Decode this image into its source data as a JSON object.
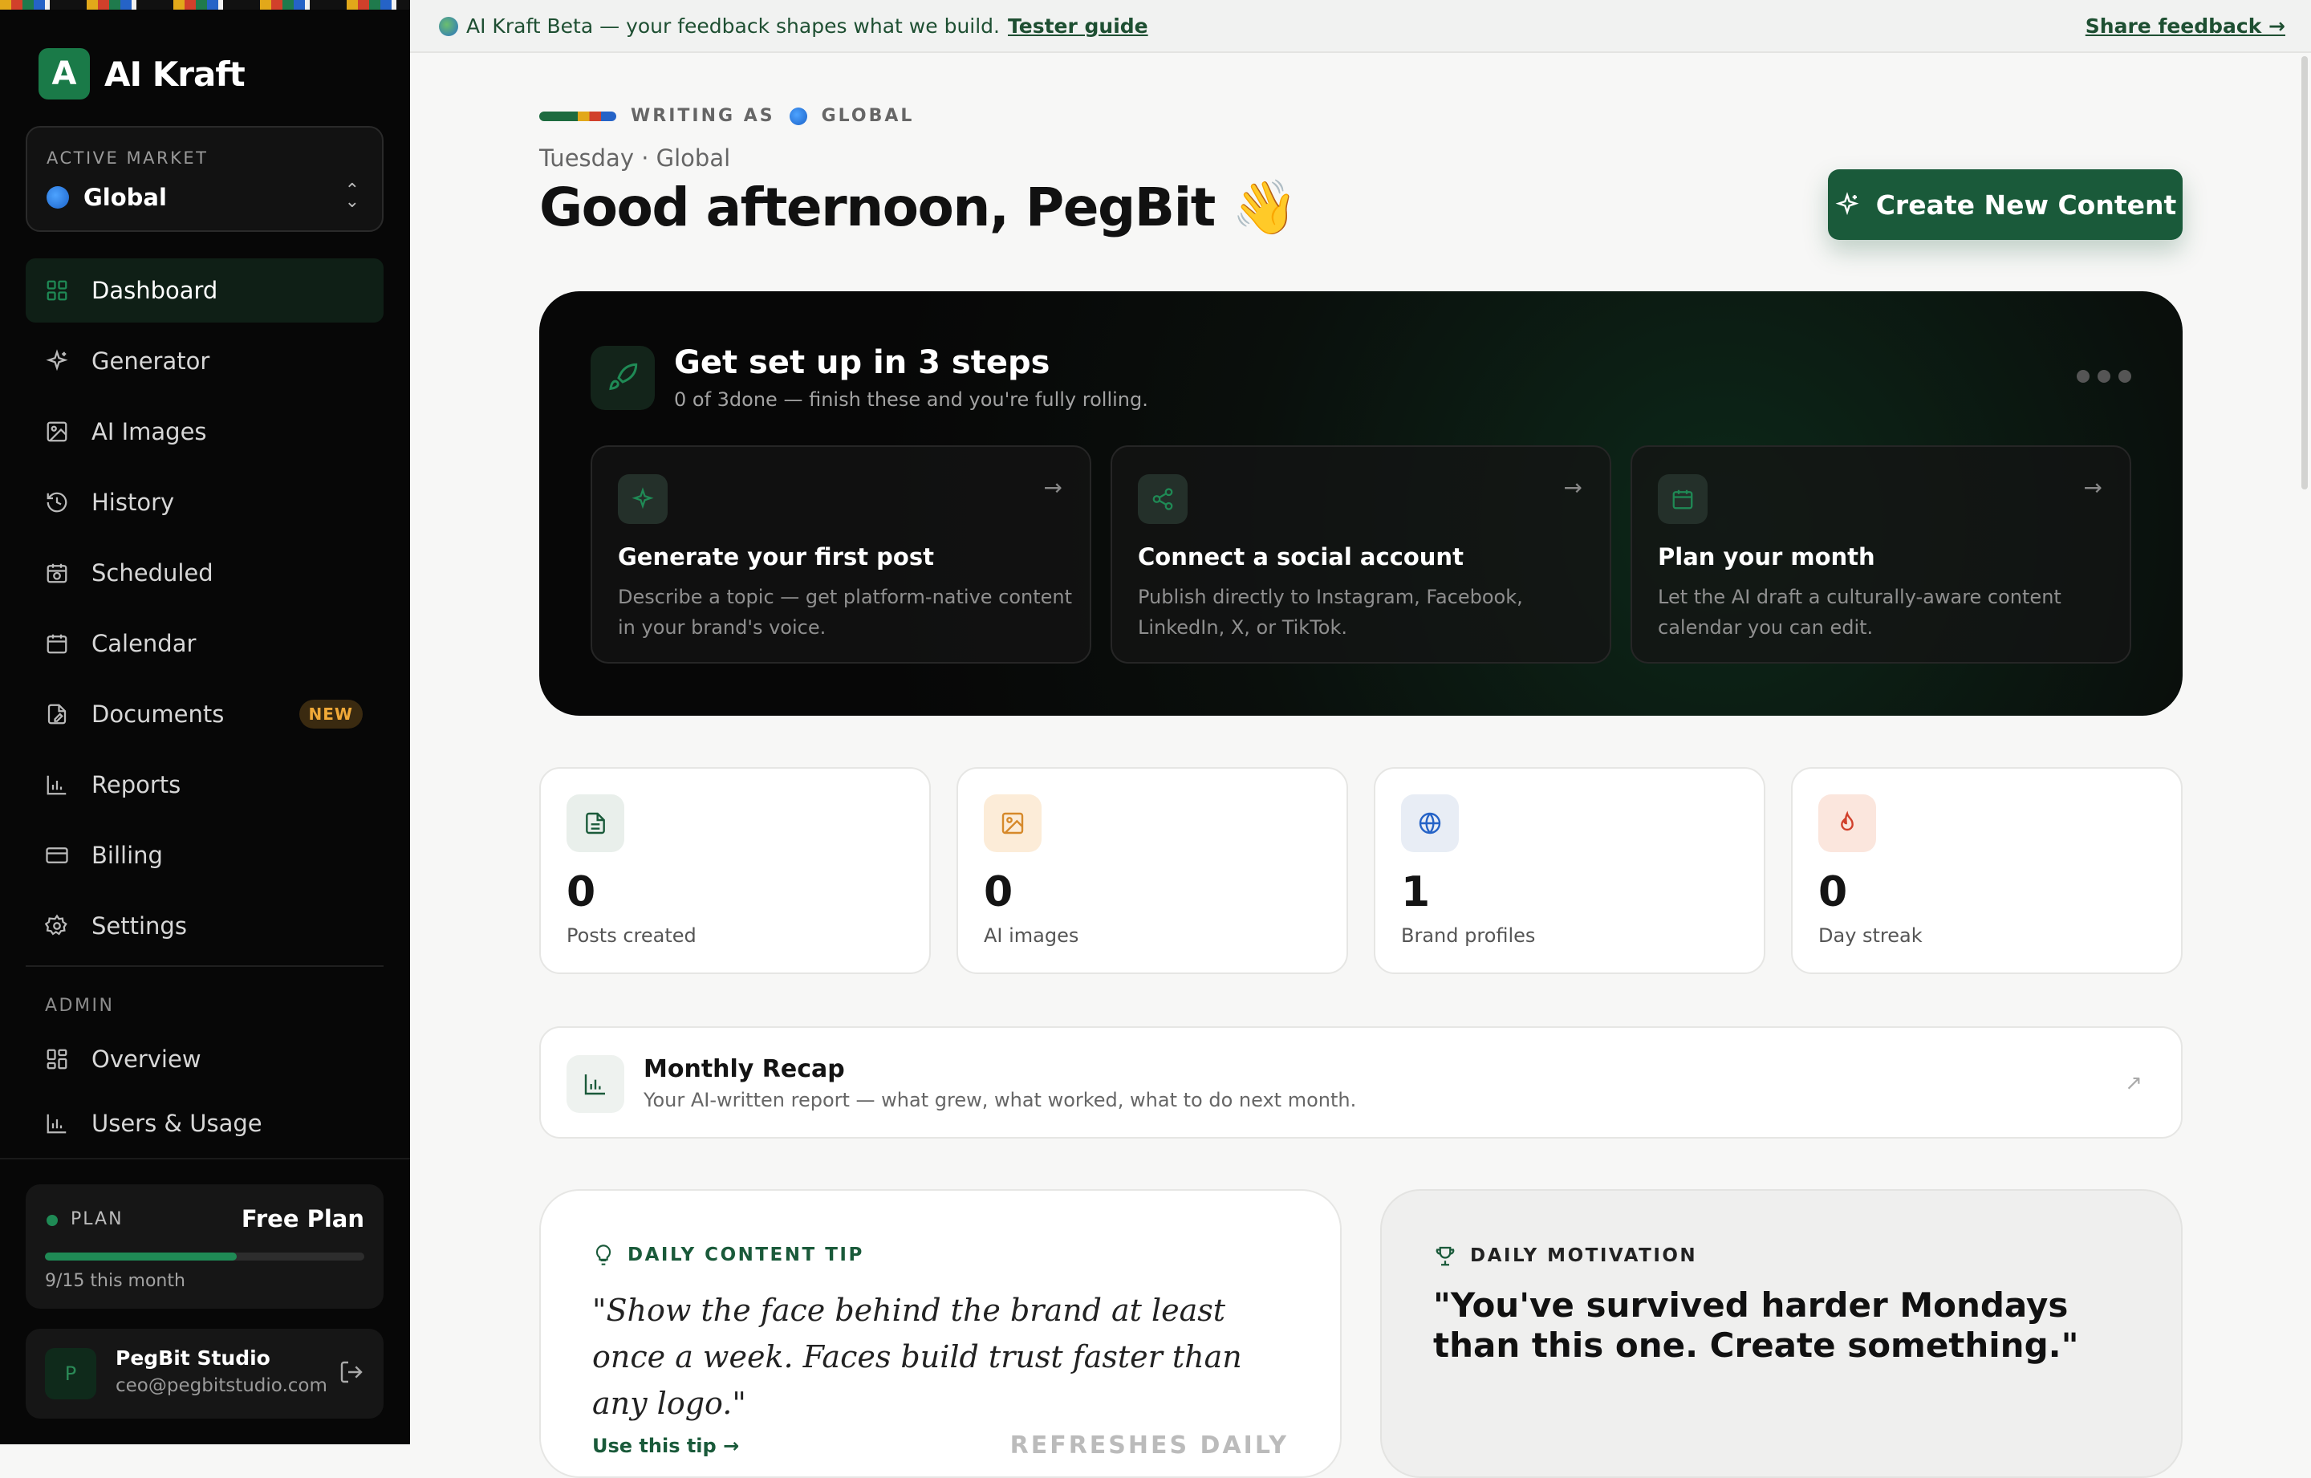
{
  "app": {
    "name": "AI Kraft",
    "logo_letter": "A"
  },
  "market": {
    "label": "ACTIVE MARKET",
    "value": "Global"
  },
  "nav": [
    {
      "id": "dashboard",
      "label": "Dashboard",
      "icon": "grid-icon",
      "active": true
    },
    {
      "id": "generator",
      "label": "Generator",
      "icon": "sparkles-icon"
    },
    {
      "id": "ai-images",
      "label": "AI Images",
      "icon": "image-icon"
    },
    {
      "id": "history",
      "label": "History",
      "icon": "history-icon"
    },
    {
      "id": "scheduled",
      "label": "Scheduled",
      "icon": "calendar-clock-icon"
    },
    {
      "id": "calendar",
      "label": "Calendar",
      "icon": "calendar-icon"
    },
    {
      "id": "documents",
      "label": "Documents",
      "icon": "document-edit-icon",
      "badge": "NEW"
    },
    {
      "id": "reports",
      "label": "Reports",
      "icon": "bar-chart-icon"
    },
    {
      "id": "billing",
      "label": "Billing",
      "icon": "credit-card-icon"
    },
    {
      "id": "settings",
      "label": "Settings",
      "icon": "gear-icon"
    }
  ],
  "admin": {
    "label": "ADMIN",
    "items": [
      {
        "id": "overview",
        "label": "Overview",
        "icon": "dashboard-icon"
      },
      {
        "id": "users-usage",
        "label": "Users & Usage",
        "icon": "bar-chart-icon"
      }
    ]
  },
  "plan": {
    "label": "PLAN",
    "value": "Free Plan",
    "usage_text": "9/15 this month",
    "used": 9,
    "total": 15
  },
  "user": {
    "initial": "P",
    "name": "PegBit Studio",
    "email": "ceo@pegbitstudio.com"
  },
  "banner": {
    "text": "AI Kraft Beta — your feedback shapes what we build.",
    "link": "Tester guide",
    "share": "Share feedback →"
  },
  "header": {
    "writing_as_label": "WRITING AS",
    "writing_as_value": "GLOBAL",
    "date": "Tuesday · Global",
    "greeting": "Good afternoon, PegBit",
    "wave": "👋",
    "create_button": "Create New Content"
  },
  "setup": {
    "title": "Get set up in 3 steps",
    "subtitle": "0 of 3done — finish these and you're fully rolling.",
    "steps": [
      {
        "title": "Generate your first post",
        "desc": "Describe a topic — get platform-native content in your brand's voice.",
        "icon": "sparkles-icon"
      },
      {
        "title": "Connect a social account",
        "desc": "Publish directly to Instagram, Facebook, LinkedIn, X, or TikTok.",
        "icon": "share-icon"
      },
      {
        "title": "Plan your month",
        "desc": "Let the AI draft a culturally-aware content calendar you can edit.",
        "icon": "calendar-icon"
      }
    ]
  },
  "stats": [
    {
      "value": "0",
      "label": "Posts created",
      "icon": "document-icon",
      "color": "#1a5a3a",
      "bg": "#e9efeb"
    },
    {
      "value": "0",
      "label": "AI images",
      "icon": "image-icon",
      "color": "#d6892a",
      "bg": "#fcecd8"
    },
    {
      "value": "1",
      "label": "Brand profiles",
      "icon": "globe-icon",
      "color": "#2563c7",
      "bg": "#e8edf5"
    },
    {
      "value": "0",
      "label": "Day streak",
      "icon": "flame-icon",
      "color": "#d1402b",
      "bg": "#fbe6dd"
    }
  ],
  "recap": {
    "title": "Monthly Recap",
    "desc": "Your AI-written report — what grew, what worked, what to do next month."
  },
  "tip": {
    "label": "DAILY CONTENT TIP",
    "quote": "\"Show the face behind the brand at least once a week. Faces build trust faster than any logo.\"",
    "link": "Use this tip →",
    "refresh": "REFRESHES DAILY"
  },
  "motivation": {
    "label": "DAILY MOTIVATION",
    "quote": "\"You've survived harder Mondays than this one. Create something.\""
  }
}
